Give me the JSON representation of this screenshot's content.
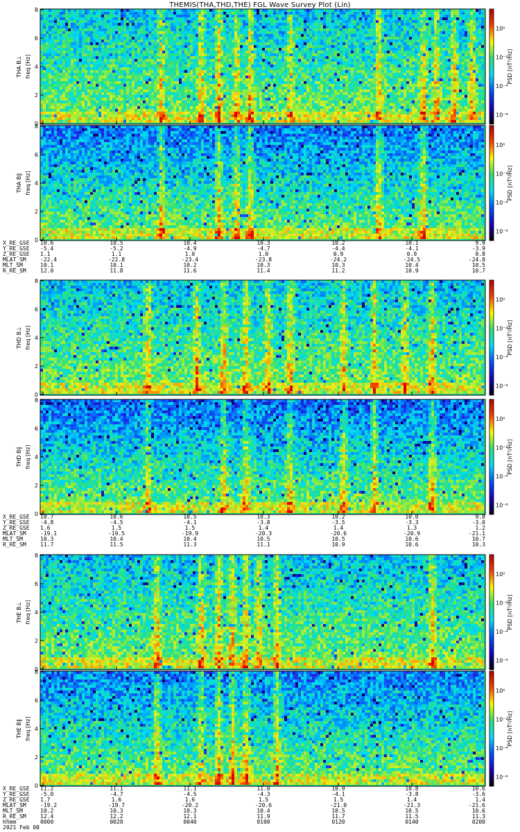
{
  "chart_data": {
    "type": "heatmap",
    "title": "THEMIS(THA,THD,THE) FGL Wave Survey Plot (Lin)",
    "date_label": "2021 Feb 08",
    "colorbar": {
      "label_html": "PSD [nT²/Hz]",
      "label": "PSD [nT^2/Hz]",
      "tick_labels": [
        "10⁰",
        "10⁻²",
        "10⁻⁴",
        "10⁻⁶"
      ],
      "scale": "log",
      "colors": [
        "#000000",
        "#1a00c0",
        "#0050ff",
        "#00e0ff",
        "#30e070",
        "#ffff00",
        "#ff4000",
        "#b00000"
      ]
    },
    "panels": [
      {
        "id": "tha_bl",
        "label": "THA B⊥",
        "ylabel": "freq [Hz]",
        "ylim": [
          0,
          8
        ],
        "yticks": [
          "0",
          "2",
          "4",
          "6",
          "8"
        ],
        "cb_ticks": [
          "10⁰",
          "10⁻²",
          "10⁻⁴",
          "10⁻⁶"
        ],
        "bright_bands": [
          0.27,
          0.36,
          0.4,
          0.44,
          0.47,
          0.56,
          0.76,
          0.86,
          0.89,
          0.93,
          0.97
        ],
        "quiet": 0.35
      },
      {
        "id": "tha_bll",
        "label": "THA B∥",
        "ylabel": "freq [Hz]",
        "ylim": [
          0,
          8
        ],
        "yticks": [
          "0",
          "2",
          "4",
          "6",
          "8"
        ],
        "cb_ticks": [
          "10⁰",
          "10⁻²",
          "10⁻⁴",
          "10⁻⁶"
        ],
        "bright_bands": [
          0.27,
          0.4,
          0.44,
          0.47,
          0.76,
          0.86
        ],
        "quiet": 0.7
      },
      {
        "id": "thd_bl",
        "label": "THD B⊥",
        "ylabel": "freq [Hz]",
        "ylim": [
          0,
          8
        ],
        "yticks": [
          "0",
          "2",
          "4",
          "6",
          "8"
        ],
        "cb_ticks": [
          "10⁰",
          "10⁻²",
          "10⁻⁴",
          "10⁻⁶"
        ],
        "bright_bands": [
          0.24,
          0.35,
          0.41,
          0.46,
          0.51,
          0.56,
          0.68,
          0.75,
          0.82,
          0.88
        ],
        "quiet": 0.35
      },
      {
        "id": "thd_bll",
        "label": "THD B∥",
        "ylabel": "freq [Hz]",
        "ylim": [
          0,
          8
        ],
        "yticks": [
          "0",
          "2",
          "4",
          "6",
          "8"
        ],
        "cb_ticks": [
          "10⁰",
          "10⁻²",
          "10⁻⁴",
          "10⁻⁶"
        ],
        "bright_bands": [
          0.24,
          0.41,
          0.46,
          0.56,
          0.68,
          0.75,
          0.88
        ],
        "quiet": 0.75
      },
      {
        "id": "the_bl",
        "label": "THE B⊥",
        "ylabel": "freq [Hz]",
        "ylim": [
          0,
          8
        ],
        "yticks": [
          "0",
          "2",
          "4",
          "6",
          "8"
        ],
        "cb_ticks": [
          "10⁰",
          "10⁻²",
          "10⁻⁴",
          "10⁻⁶"
        ],
        "bright_bands": [
          0.26,
          0.36,
          0.4,
          0.43,
          0.46,
          0.49,
          0.53,
          0.88
        ],
        "quiet": 0.35
      },
      {
        "id": "the_bll",
        "label": "THE B∥",
        "ylabel": "freq [Hz]",
        "ylim": [
          0,
          8
        ],
        "yticks": [
          "0",
          "2",
          "4",
          "6",
          "8"
        ],
        "cb_ticks": [
          "10⁰",
          "10⁻²",
          "10⁻⁴",
          "10⁻⁶"
        ],
        "bright_bands": [
          0.26,
          0.36,
          0.4,
          0.43,
          0.46,
          0.53
        ],
        "quiet": 0.65
      }
    ],
    "ephemeris_blocks": [
      {
        "rows": [
          {
            "name": "X_RE_GSE",
            "values": [
              "10.6",
              "10.5",
              "10.4",
              "10.3",
              "10.2",
              "10.1",
              "9.9"
            ]
          },
          {
            "name": "Y_RE_GSE",
            "values": [
              "-5.4",
              "-5.2",
              "-4.9",
              "-4.7",
              "-4.4",
              "-4.1",
              "-3.9"
            ]
          },
          {
            "name": "Z_RE_GSE",
            "values": [
              "1.1",
              "1.1",
              "1.0",
              "1.0",
              "0.9",
              "0.9",
              "0.8"
            ]
          },
          {
            "name": "MLAT_SM",
            "values": [
              "-22.4",
              "-22.8",
              "-23.4",
              "-23.8",
              "-24.2",
              "-24.5",
              "-24.8"
            ]
          },
          {
            "name": "MLT_SM",
            "values": [
              "10.1",
              "10.1",
              "10.2",
              "10.3",
              "10.3",
              "10.4",
              "10.5"
            ]
          },
          {
            "name": "R_RE_SM",
            "values": [
              "12.0",
              "11.8",
              "11.6",
              "11.4",
              "11.2",
              "10.9",
              "10.7"
            ]
          }
        ]
      },
      {
        "rows": [
          {
            "name": "X_RE_GSE",
            "values": [
              "10.7",
              "10.6",
              "10.5",
              "10.3",
              "10.2",
              "10.0",
              "9.8"
            ]
          },
          {
            "name": "Y_RE_GSE",
            "values": [
              "-4.8",
              "-4.5",
              "-4.1",
              "-3.8",
              "-3.5",
              "-3.3",
              "-3.0"
            ]
          },
          {
            "name": "Z_RE_GSE",
            "values": [
              "1.6",
              "1.5",
              "1.5",
              "1.4",
              "1.4",
              "1.3",
              "1.2"
            ]
          },
          {
            "name": "MLAT_SM",
            "values": [
              "-19.1",
              "-19.5",
              "-19.9",
              "-20.3",
              "-20.6",
              "-20.9",
              "-21.1"
            ]
          },
          {
            "name": "MLT_SM",
            "values": [
              "10.3",
              "10.4",
              "10.4",
              "10.5",
              "10.5",
              "10.6",
              "10.7"
            ]
          },
          {
            "name": "R_RE_SM",
            "values": [
              "11.7",
              "11.5",
              "11.3",
              "11.1",
              "10.9",
              "10.6",
              "10.3"
            ]
          }
        ]
      },
      {
        "rows": [
          {
            "name": "X_RE_GSE",
            "values": [
              "11.2",
              "11.1",
              "11.1",
              "11.0",
              "10.9",
              "10.8",
              "10.6"
            ]
          },
          {
            "name": "Y_RE_GSE",
            "values": [
              "-5.0",
              "-4.7",
              "-4.5",
              "-4.3",
              "-4.1",
              "-3.8",
              "-3.6"
            ]
          },
          {
            "name": "Z_RE_GSE",
            "values": [
              "1.7",
              "1.6",
              "1.6",
              "1.5",
              "1.5",
              "1.4",
              "1.4"
            ]
          },
          {
            "name": "MLAT_SM",
            "values": [
              "-19.2",
              "-19.7",
              "-20.2",
              "-20.6",
              "-21.0",
              "-21.3",
              "-21.6"
            ]
          },
          {
            "name": "MLT_SM",
            "values": [
              "10.2",
              "10.3",
              "10.3",
              "10.4",
              "10.5",
              "10.5",
              "10.6"
            ]
          },
          {
            "name": "R_RE_SM",
            "values": [
              "12.4",
              "12.2",
              "12.1",
              "11.9",
              "11.7",
              "11.5",
              "11.3"
            ]
          },
          {
            "name": "hhmm",
            "values": [
              "0000",
              "0020",
              "0040",
              "0100",
              "0120",
              "0140",
              "0200"
            ]
          }
        ]
      }
    ]
  }
}
